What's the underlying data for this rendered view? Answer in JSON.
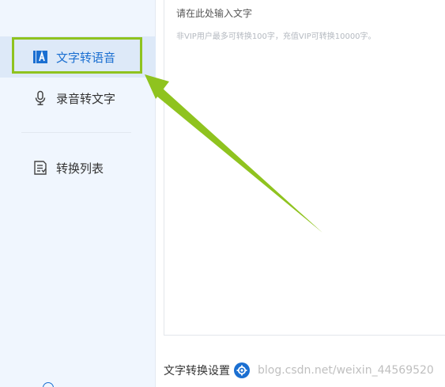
{
  "sidebar": {
    "items": [
      {
        "label": "文字转语音",
        "icon": "text-a-icon"
      },
      {
        "label": "录音转文字",
        "icon": "microphone-icon"
      },
      {
        "label": "转换列表",
        "icon": "list-document-icon"
      }
    ]
  },
  "editor": {
    "placeholder": "请在此处输入文字",
    "hint": "非VIP用户最多可转换100字，充值VIP可转换10000字。"
  },
  "settings": {
    "label": "文字转换设置",
    "icon": "gear-icon"
  },
  "watermark": "blog.csdn.net/weixin_44569520",
  "colors": {
    "accent": "#1b6fd1",
    "highlight": "#8fc31f",
    "sidebar_bg": "#f0f6fe"
  }
}
